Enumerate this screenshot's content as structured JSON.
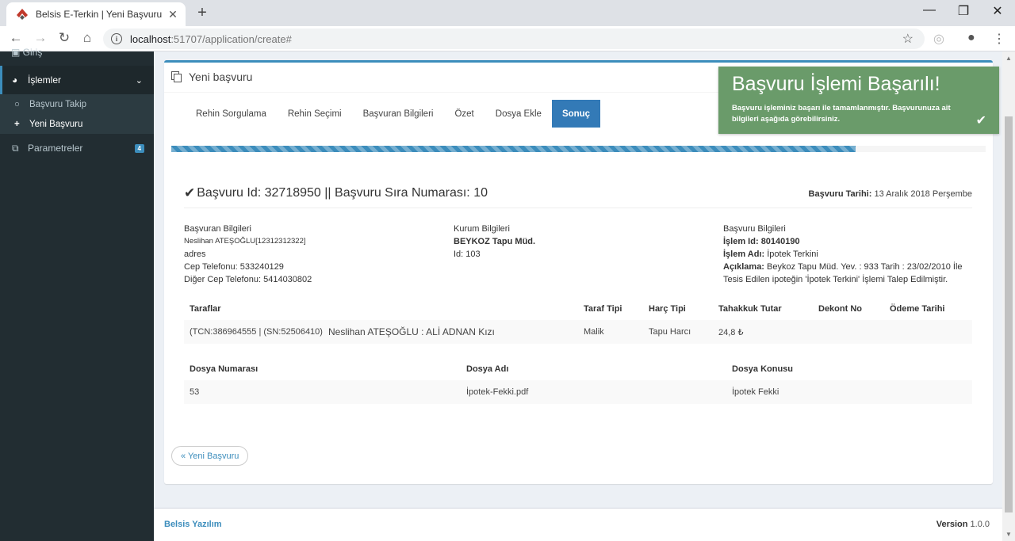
{
  "browser": {
    "tab_title": "Belsis E-Terkin | Yeni Başvuru",
    "url_host": "localhost",
    "url_path": ":51707/application/create#"
  },
  "sidebar": {
    "cut_label": "Giriş",
    "menu_label": "İşlemler",
    "sub_items": [
      "Başvuru Takip",
      "Yeni Başvuru"
    ],
    "param_label": "Parametreler",
    "param_badge": "4"
  },
  "box": {
    "title": "Yeni başvuru",
    "steps": [
      "Rehin Sorgulama",
      "Rehin Seçimi",
      "Başvuran Bilgileri",
      "Özet",
      "Dosya Ekle",
      "Sonuç"
    ],
    "active_step": "Sonuç",
    "progress": 0.84
  },
  "summary": {
    "heading": "Başvuru Id: 32718950 || Başvuru Sıra Numarası: 10",
    "date_label": "Başvuru Tarihi:",
    "date_value": "13 Aralık 2018 Perşembe"
  },
  "applicant": {
    "title": "Başvuran Bilgileri",
    "name": "Neslihan ATEŞOĞLU[12312312322]",
    "address": "adres",
    "phone_label": "Cep Telefonu:",
    "phone": "533240129",
    "phone2_label": "Diğer Cep Telefonu:",
    "phone2": "5414030802"
  },
  "institution": {
    "title": "Kurum Bilgileri",
    "name": "BEYKOZ Tapu Müd.",
    "id_label": "Id:",
    "id": "103"
  },
  "application": {
    "title": "Başvuru Bilgileri",
    "op_id_label": "İşlem Id:",
    "op_id": "80140190",
    "op_name_label": "İşlem Adı:",
    "op_name": "İpotek Terkini",
    "desc_label": "Açıklama:",
    "desc_line1": "Beykoz Tapu Müd. Yev. : 933 Tarih : 23/02/2010 İle",
    "desc_line2": "Tesis Edilen ipoteğin 'İpotek Terkini' İşlemi Talep Edilmiştir."
  },
  "parties": {
    "headers": [
      "Taraflar",
      "Taraf Tipi",
      "Harç Tipi",
      "Tahakkuk Tutar",
      "Dekont No",
      "Ödeme Tarihi"
    ],
    "row": {
      "tcn": "(TCN:386964555 | (SN:52506410)",
      "name": "Neslihan ATEŞOĞLU : ALİ ADNAN Kızı",
      "type": "Malik",
      "fee_type": "Tapu Harcı",
      "amount": "24,8 ₺",
      "receipt": "",
      "pay_date": ""
    }
  },
  "files": {
    "headers": [
      "Dosya Numarası",
      "Dosya Adı",
      "Dosya Konusu"
    ],
    "row": {
      "no": "53",
      "name": "İpotek-Fekki.pdf",
      "subject": "İpotek Fekki"
    }
  },
  "back_button": "« Yeni Başvuru",
  "toast": {
    "title": "Başvuru İşlemi Başarılı!",
    "message": "Başvuru işleminiz başarı ile tamamlanmıştır. Başvurunuza ait bilgileri aşağıda görebilirsiniz."
  },
  "footer": {
    "brand": "Belsis Yazılım",
    "version_label": "Version",
    "version": "1.0.0"
  },
  "colors": {
    "accent": "#3c8dbc",
    "sidebar": "#222d32",
    "toast": "#6a9b6a",
    "step_active": "#337ab7"
  },
  "icons": [
    "back-arrow-icon",
    "forward-arrow-icon",
    "reload-icon",
    "home-icon",
    "info-icon",
    "star-icon",
    "account-icon",
    "menu-icon",
    "dashboard-icon",
    "circle-icon",
    "plus-icon",
    "copy-icon",
    "check-icon"
  ]
}
